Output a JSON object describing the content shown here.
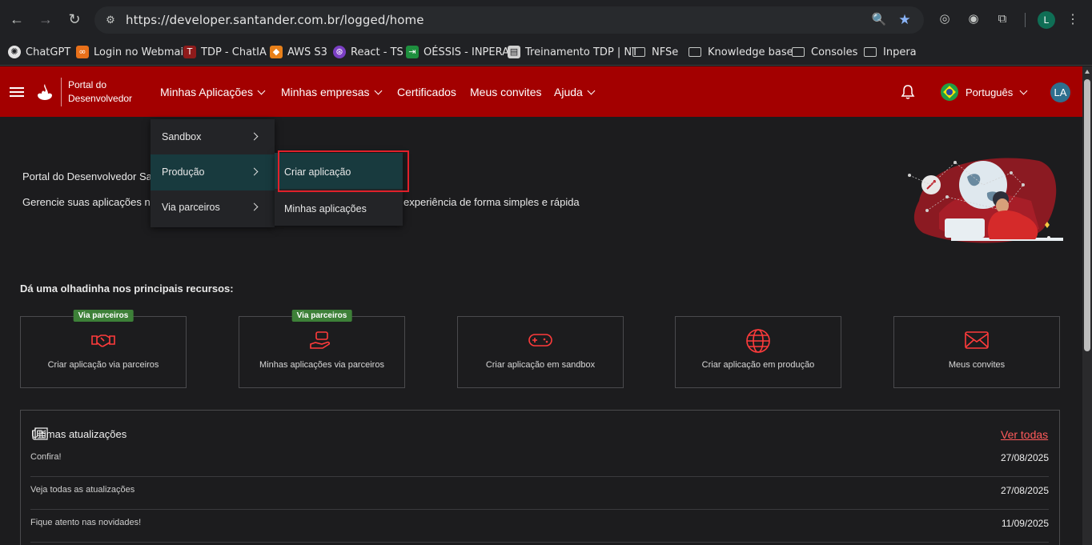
{
  "browser": {
    "url": "https://developer.santander.com.br/logged/home",
    "profile_initial": "L",
    "bookmarks": [
      "ChatGPT",
      "Login no Webmail",
      "TDP - ChatIA",
      "AWS S3",
      "React - TS",
      "OÉSSIS - INPERA",
      "Treinamento TDP | NT",
      "NFSe",
      "Knowledge base",
      "Consoles",
      "Inpera"
    ]
  },
  "header": {
    "logo_line1": "Portal do",
    "logo_line2": "Desenvolvedor",
    "menu": [
      "Minhas Aplicações",
      "Minhas empresas",
      "Certificados",
      "Meus convites",
      "Ajuda"
    ],
    "language": "Português",
    "avatar": "LA"
  },
  "dropdown": {
    "items": [
      "Sandbox",
      "Produção",
      "Via parceiros"
    ],
    "submenu": [
      "Criar aplicação",
      "Minhas aplicações"
    ]
  },
  "hero": {
    "title": "Portal do Desenvolvedor San",
    "subtitle_start": "Gerencie suas aplicações no",
    "subtitle_end": "experiência de forma simples e rápida"
  },
  "resources": {
    "title": "Dá uma olhadinha nos principais recursos:",
    "cards": [
      {
        "label": "Criar aplicação via parceiros",
        "badge": "Via parceiros"
      },
      {
        "label": "Minhas aplicações via parceiros",
        "badge": "Via parceiros"
      },
      {
        "label": "Criar aplicação em sandbox",
        "badge": ""
      },
      {
        "label": "Criar aplicação em produção",
        "badge": ""
      },
      {
        "label": "Meus convites",
        "badge": ""
      }
    ]
  },
  "updates": {
    "title": "Últimas atualizações",
    "see_all": "Ver todas",
    "rows": [
      {
        "text": "Confira!",
        "date": "27/08/2025"
      },
      {
        "text": "Veja todas as atualizações",
        "date": "27/08/2025"
      },
      {
        "text": "Fique atento nas novidades!",
        "date": "11/09/2025"
      }
    ]
  },
  "colors": {
    "brand_red": "#a30000",
    "badge_green": "#3d8038",
    "highlight": "#e0202a"
  }
}
